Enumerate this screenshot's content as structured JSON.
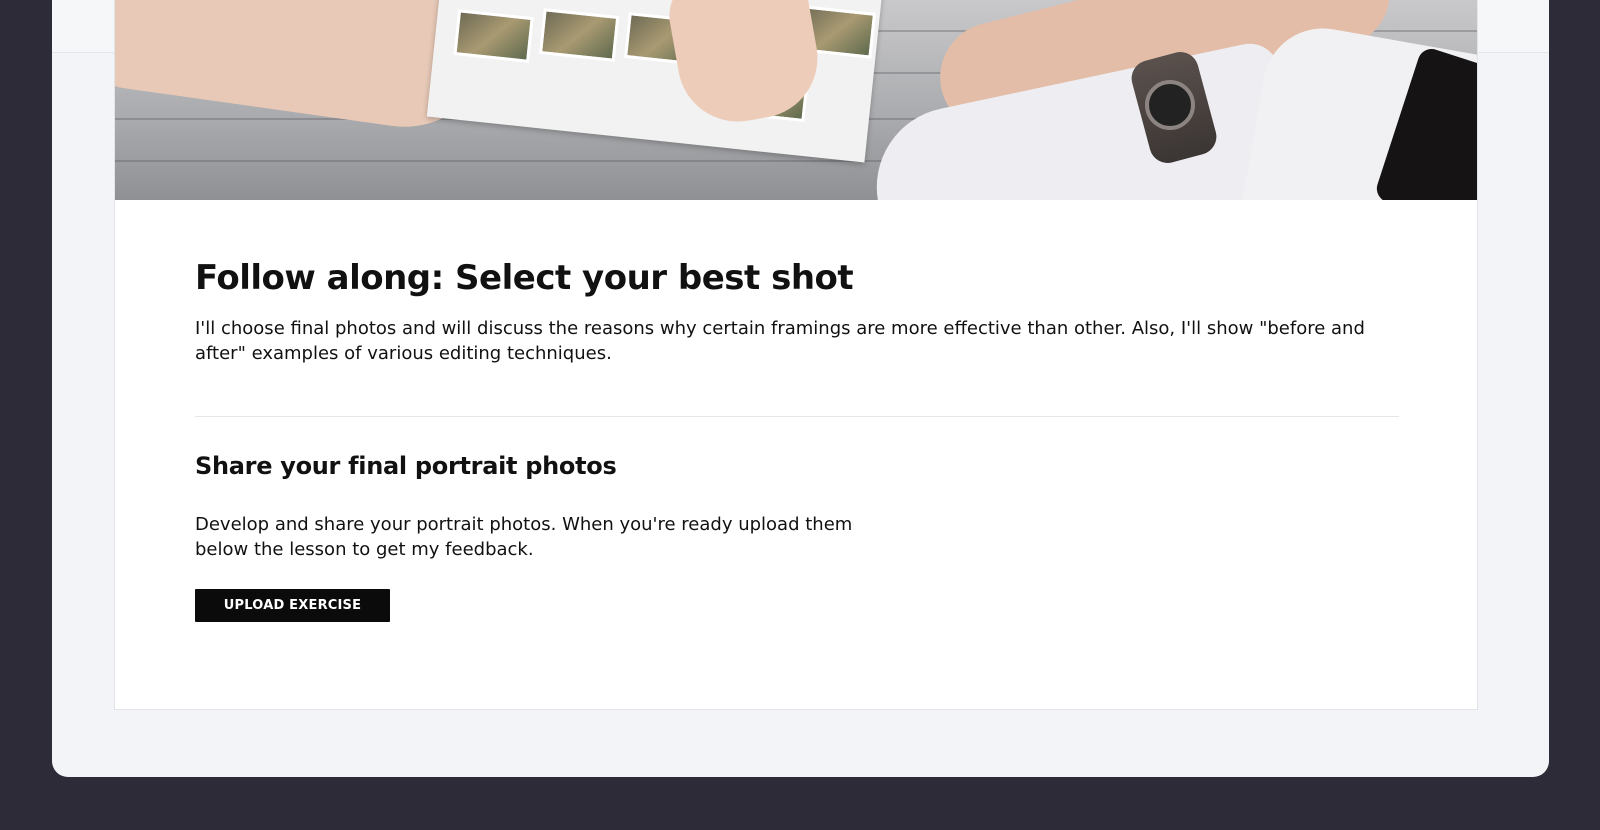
{
  "lesson": {
    "hero_image": {
      "alt": "hands-selecting-photos-on-table"
    },
    "title": "Follow along: Select your best shot",
    "description": "I'll choose final photos and will discuss the reasons why certain framings are more effective than other. Also, I'll show \"before and after\" examples of various editing techniques."
  },
  "exercise": {
    "title": "Share your final portrait photos",
    "description": "Develop and share your portrait photos. When you're ready upload them below the lesson to get my feedback.",
    "upload_label": "UPLOAD EXERCISE"
  },
  "colors": {
    "backdrop": "#2e2b38",
    "window_bg": "#f3f4f7",
    "button_bg": "#0b0b0c",
    "text": "#111111"
  }
}
